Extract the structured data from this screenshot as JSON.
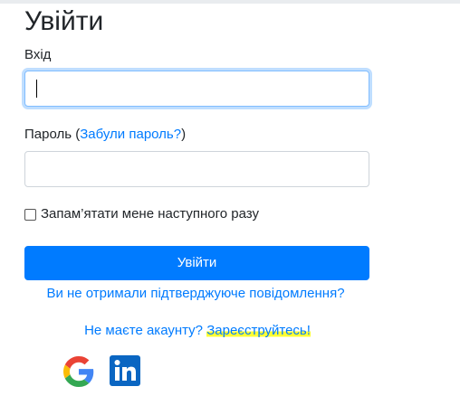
{
  "page": {
    "title": "Увійти",
    "login_label": "Вхід",
    "login_value": "",
    "password_label_prefix": "Пароль (",
    "forgot_link": "Забули пароль?",
    "password_label_suffix": ")",
    "password_value": "",
    "remember_label": "Запам’ятати мене наступного разу",
    "login_button": "Увійти",
    "resend_link": "Ви не отримали підтверджуюче повідомлення?",
    "no_account_text": "Не маєте акаунту? ",
    "register_link": "Зареєструйтесь!"
  },
  "social": [
    {
      "icon": "google-icon"
    },
    {
      "icon": "linkedin-icon"
    }
  ],
  "colors": {
    "primary": "#007bff",
    "highlight": "#ffff33",
    "linkedin": "#0a66c2"
  }
}
